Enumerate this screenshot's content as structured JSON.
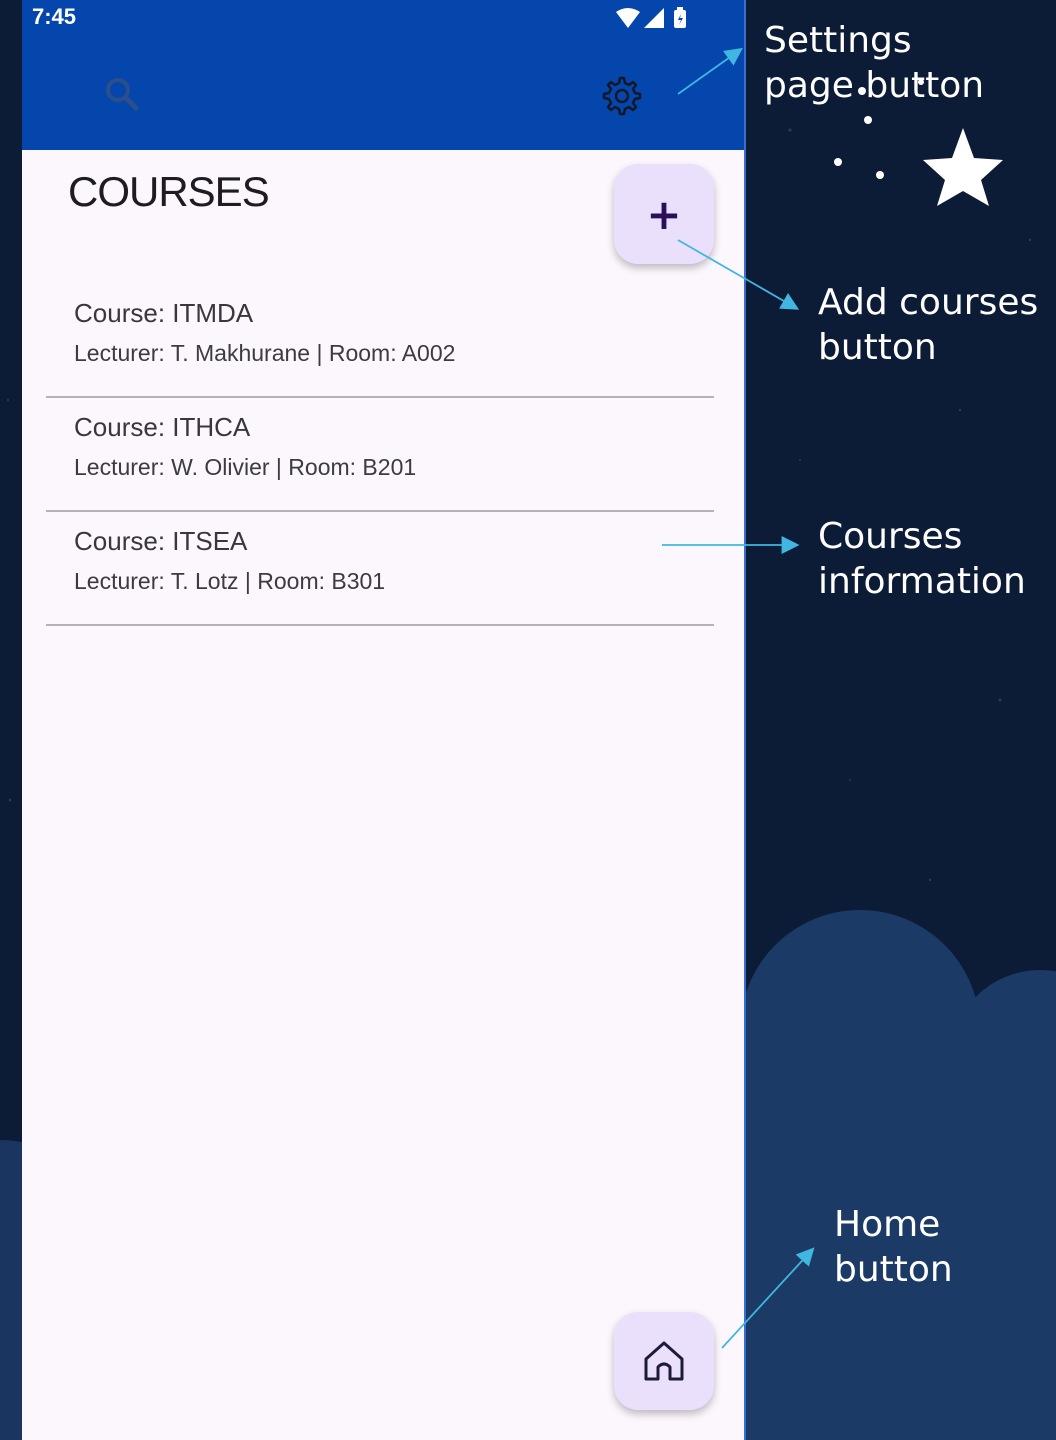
{
  "status_bar": {
    "time": "7:45"
  },
  "page": {
    "title": "COURSES",
    "add_label": "+"
  },
  "courses": [
    {
      "course": "Course: ITMDA",
      "detail": "Lecturer: T. Makhurane | Room: A002"
    },
    {
      "course": "Course: ITHCA",
      "detail": "Lecturer: W. Olivier | Room: B201"
    },
    {
      "course": "Course: ITSEA",
      "detail": "Lecturer: T. Lotz | Room: B301"
    }
  ],
  "annotations": {
    "settings": [
      "Settings",
      "page button"
    ],
    "add": [
      "Add courses",
      "button"
    ],
    "info": [
      "Courses",
      "information"
    ],
    "home": [
      "Home",
      "button"
    ]
  },
  "colors": {
    "appbar": "#0546ac",
    "background": "#0d1c36",
    "fab": "#ebe0fb",
    "annotation_arrow": "#3fb7e0"
  },
  "icons": [
    "search-icon",
    "settings-gear-icon",
    "add-icon",
    "home-icon",
    "wifi-icon",
    "signal-icon",
    "battery-icon",
    "star-icon"
  ]
}
